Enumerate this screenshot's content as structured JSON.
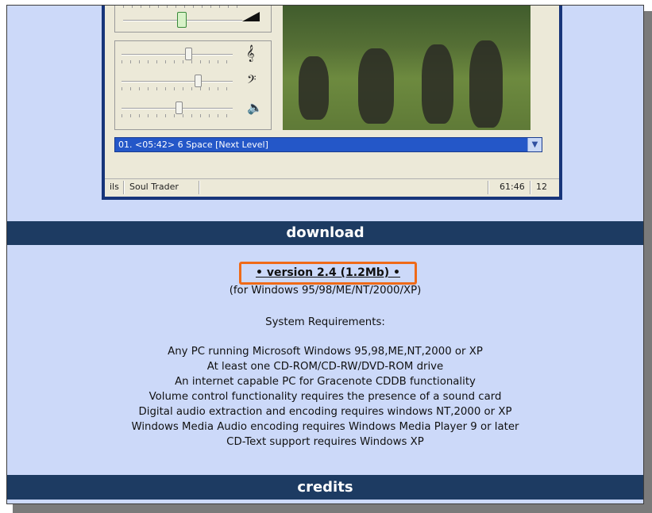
{
  "player": {
    "track_list_value": "01. <05:42> 6 Space [Next Level]",
    "status_left": "ils",
    "status_artist": "Soul Trader",
    "status_time": "61:46",
    "status_track_count": "12",
    "controls": [
      {
        "name": "treble-slider",
        "icon": "treble-clef-icon"
      },
      {
        "name": "bass-slider",
        "icon": "bass-clef-icon"
      },
      {
        "name": "balance-slider",
        "icon": "speaker-icon"
      }
    ]
  },
  "download": {
    "heading": "download",
    "link_label": "• version 2.4 (1.2Mb) •",
    "platforms": "(for Windows 95/98/ME/NT/2000/XP)",
    "requirements_heading": "System Requirements:",
    "requirements": [
      "Any PC running Microsoft Windows 95,98,ME,NT,2000 or XP",
      "At least one CD-ROM/CD-RW/DVD-ROM drive",
      "An internet capable PC for Gracenote CDDB functionality",
      "Volume control functionality requires the presence of a sound card",
      "Digital audio extraction and encoding requires windows NT,2000 or XP",
      "Windows Media Audio encoding requires Windows Media Player 9 or later",
      "CD-Text support requires Windows XP"
    ]
  },
  "credits": {
    "heading": "credits"
  },
  "colors": {
    "page_background": "#ccd9f9",
    "section_bar": "#1d3b62",
    "highlight_box": "#ef6a18"
  }
}
